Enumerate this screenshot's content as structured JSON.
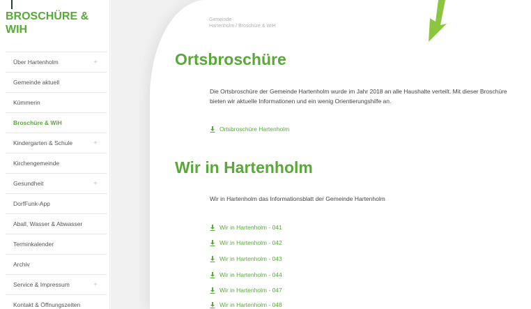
{
  "sidebar": {
    "title": "BROSCHÜRE & WIH",
    "items": [
      {
        "label": "Über Hartenholm",
        "expand": "+"
      },
      {
        "label": "Gemeinde aktuell"
      },
      {
        "label": "Kümmerin"
      },
      {
        "label": "Broschüre & WiH",
        "active": true
      },
      {
        "label": "Kindergarten & Schule",
        "expand": "+"
      },
      {
        "label": "Kirchengemeinde"
      },
      {
        "label": "Gesundheit",
        "expand": "+"
      },
      {
        "label": "DorfFunk-App"
      },
      {
        "label": "Aball, Wasser & Abwasser"
      },
      {
        "label": "Terminkalender"
      },
      {
        "label": "Archiv"
      },
      {
        "label": "Service & Impressum",
        "expand": "+"
      },
      {
        "label": "Kontakt & Öffnungszeiten"
      }
    ]
  },
  "breadcrumb": {
    "line1": "Gemeinde",
    "line2": "Hartenholm / Broschüre & WiH"
  },
  "sections": {
    "ortsbroschuere": {
      "heading": "Ortsbroschüre",
      "text": "Die Ortsbroschüre der Gemeinde Hartenholm wurde im Jahr 2018 an alle Haushalte verteilt. Mit dieser Broschüre bieten wir aktuelle Informationen und ein wenig Orientierungshilfe an.",
      "link": "Ortsbroschüre Hartenholm"
    },
    "wir": {
      "heading": "Wir in Hartenholm",
      "text": "Wir in Hartenholm das Informationsblatt der Gemeinde Hartenholm",
      "links": [
        "Wir in Hartenholm - 041",
        "Wir in Hartenholm - 042",
        "Wir in Hartenholm - 043",
        "Wir in Hartenholm - 044",
        "Wir in Hartenholm - 047",
        "Wir in Hartenholm - 048"
      ]
    }
  },
  "colors": {
    "accent": "#5aa83a",
    "arrow": "#8cc63f",
    "text": "#444444",
    "muted": "#b0b0b0"
  },
  "icons": {
    "download": "download-icon",
    "expand": "plus-icon",
    "decoration": "arrow-down-icon"
  }
}
